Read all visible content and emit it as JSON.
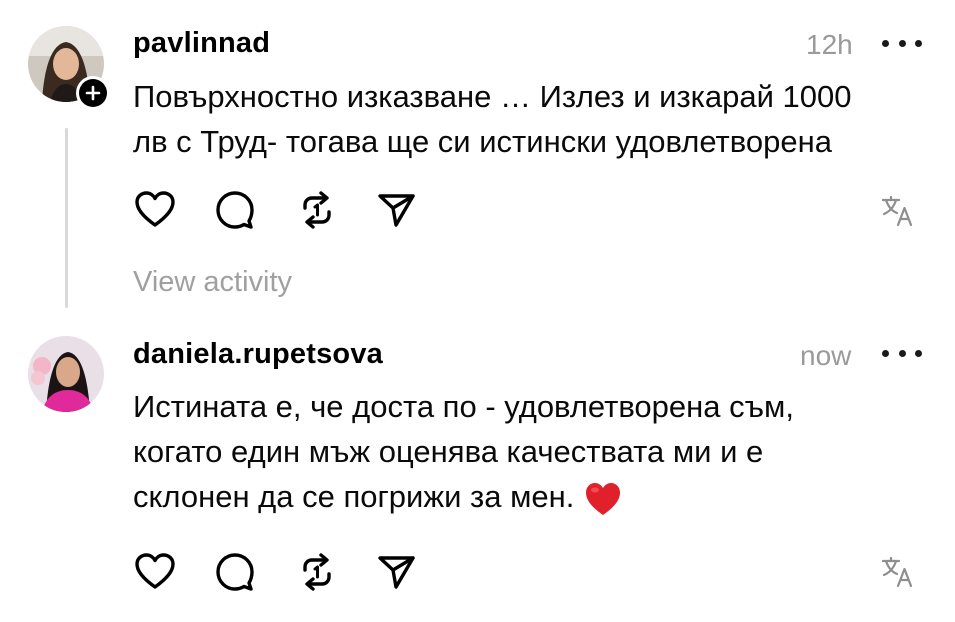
{
  "post1": {
    "username": "pavlinnad",
    "time": "12h",
    "text_line1": "Повърхностно изказване … Излез и изкарай 1000",
    "text_line2": "лв с Труд- тогава ще си истински удовлетворена",
    "view_activity": "View activity"
  },
  "post2": {
    "username": "daniela.rupetsova",
    "time": "now",
    "text_line1": "Истината е, че доста по - удовлетворена съм,",
    "text_line2": "когато един мъж оценява качествата ми и е",
    "text_line3": "склонен да се погрижи за мен."
  },
  "icons": [
    "heart-icon",
    "comment-icon",
    "repost-icon",
    "share-icon",
    "translate-icon",
    "more-icon",
    "follow-plus-icon",
    "heart-emoji-icon"
  ],
  "colors": {
    "text": "#000000",
    "muted": "#9a9a9a",
    "thread_line": "#d9d9d9",
    "heart_emoji": "#e0202a"
  }
}
